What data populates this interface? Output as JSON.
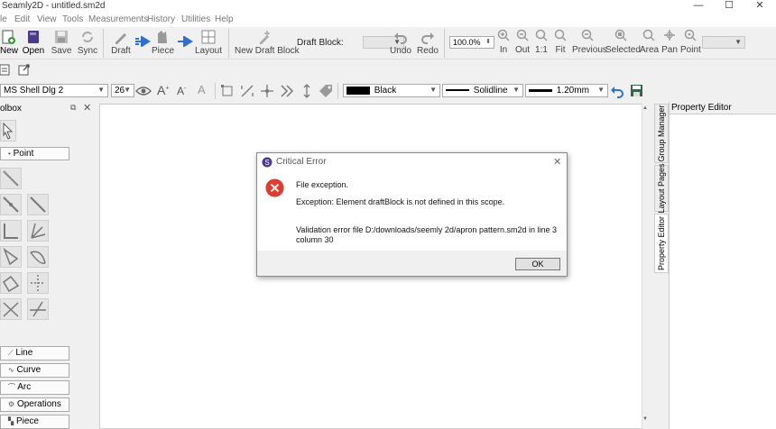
{
  "window": {
    "title": "Seamly2D - untitled.sm2d",
    "controls": [
      "—",
      "☐",
      "✕"
    ]
  },
  "menu": [
    "le",
    "Edit",
    "View",
    "Tools",
    "Measurements",
    "History",
    "Utilities",
    "Help"
  ],
  "toolbar": {
    "new": "New",
    "open": "Open",
    "save": "Save",
    "sync": "Sync",
    "draft": "Draft",
    "piece": "Piece",
    "layout": "Layout",
    "new_draft_block": "New Draft Block",
    "draft_block_label": "Draft Block:",
    "undo": "Undo",
    "redo": "Redo",
    "zoom_value": "100.0%",
    "zoom_in": "In",
    "zoom_out": "Out",
    "zoom_1to1": "1:1",
    "zoom_fit": "Fit",
    "zoom_previous": "Previous",
    "zoom_selected": "Selected",
    "zoom_area": "Area",
    "pan": "Pan",
    "point": "Point"
  },
  "format_bar": {
    "font_name": "MS Shell Dlg 2",
    "font_size": "26",
    "color": "Black",
    "line_type": "Solidline",
    "line_weight": "1.20mm"
  },
  "toolbox": {
    "title": "olbox",
    "point_group": "Point",
    "groups": [
      "Line",
      "Curve",
      "Arc",
      "Operations",
      "Piece"
    ]
  },
  "right_tabs": [
    "Property Editor",
    "Layout Pages",
    "Group Manager"
  ],
  "property_editor": {
    "title": "Property Editor"
  },
  "dialog": {
    "title": "Critical Error",
    "line1": "File exception.",
    "line2": "Exception: Element draftBlock is not defined in this scope.",
    "line3": "Validation error file D:/downloads/seemly 2d/apron pattern.sm2d in line 3",
    "line4": "column 30",
    "ok": "OK"
  },
  "colors": {
    "accent_blue": "#2f6fd6",
    "error_red": "#e23b2e",
    "purple": "#4b3a8c"
  }
}
